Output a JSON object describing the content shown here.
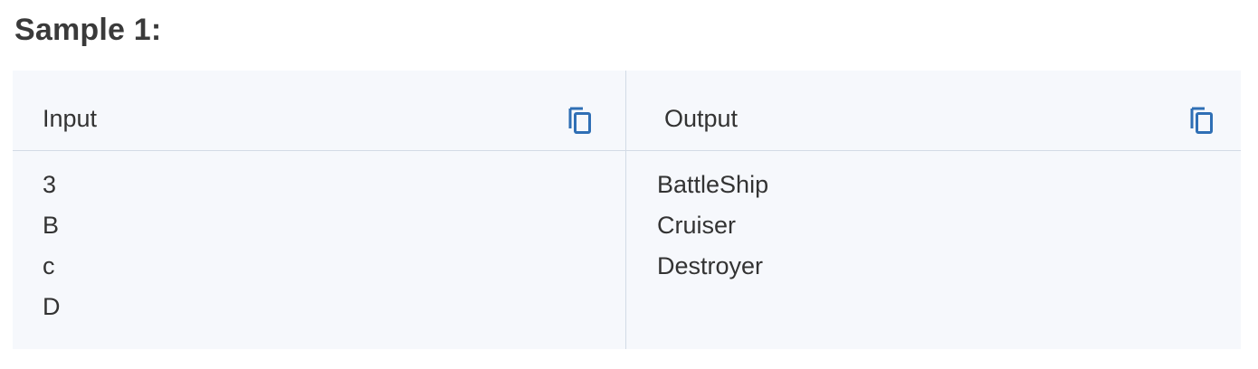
{
  "title": "Sample 1:",
  "input": {
    "header": "Input",
    "copy_icon": "copy-icon",
    "lines": [
      "3",
      "B",
      "c",
      "D"
    ]
  },
  "output": {
    "header": "Output",
    "copy_icon": "copy-icon",
    "lines": [
      "BattleShip",
      "Cruiser",
      "Destroyer"
    ]
  },
  "colors": {
    "panel_bg": "#f6f8fc",
    "divider": "#d3dbe6",
    "icon": "#2f6fb5",
    "text": "#333333"
  }
}
